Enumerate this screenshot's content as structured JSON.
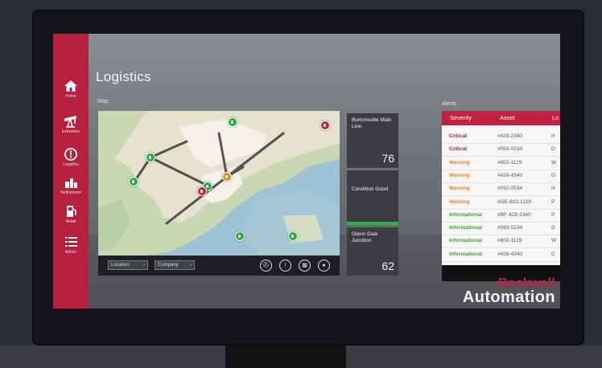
{
  "app": {
    "title": "Logistics",
    "map_label": "Map",
    "alerts_label": "Alerts"
  },
  "colors": {
    "sidebar": "#b6203f",
    "tile": "#3b3d41",
    "condition_good": "#27b34d",
    "critical": "#b2172a",
    "warning": "#ef7d1a",
    "informational": "#3e9f27"
  },
  "sidebar": {
    "items": [
      {
        "label": "Home",
        "icon": "home-icon"
      },
      {
        "label": "Extraction",
        "icon": "pumpjack-icon"
      },
      {
        "label": "Logistics",
        "icon": "alert-circle-icon"
      },
      {
        "label": "Refinement",
        "icon": "refinery-icon"
      },
      {
        "label": "Retail",
        "icon": "fuel-pump-icon"
      },
      {
        "label": "Admin",
        "icon": "list-icon"
      }
    ]
  },
  "map": {
    "toolbar": {
      "location_dropdown": "Location",
      "company_dropdown": "Company",
      "tools": [
        "pumpjack-filter-icon",
        "alert-filter-icon",
        "truck-filter-icon",
        "fuel-filter-icon"
      ]
    }
  },
  "tiles": [
    {
      "name": "Burtonsville Main Line",
      "value": "76"
    },
    {
      "name": "Condition Good",
      "value": ""
    },
    {
      "name": "Glenn Dale Junction",
      "value": "62"
    }
  ],
  "alerts": {
    "headers": [
      "Severity",
      "Asset",
      "Lo"
    ],
    "rows": [
      {
        "severity": "Critical",
        "asset": "#429-2340",
        "loc": "H"
      },
      {
        "severity": "Critical",
        "asset": "#093-0234",
        "loc": "D"
      },
      {
        "severity": "Warning",
        "asset": "#802-1129",
        "loc": "W"
      },
      {
        "severity": "Warning",
        "asset": "#426-4340",
        "loc": "O"
      },
      {
        "severity": "Warning",
        "asset": "#092-0534",
        "loc": "N"
      },
      {
        "severity": "Warning",
        "asset": "#GE-802-1129",
        "loc": "P"
      },
      {
        "severity": "Informational",
        "asset": "#BF-429-2340",
        "loc": "P"
      },
      {
        "severity": "Informational",
        "asset": "#093-0234",
        "loc": "D"
      },
      {
        "severity": "Informational",
        "asset": "#802-1129",
        "loc": "W"
      },
      {
        "severity": "Informational",
        "asset": "#426-4340",
        "loc": "C"
      }
    ]
  },
  "logo": {
    "line1": "Rockwell",
    "line2": "Automation"
  }
}
